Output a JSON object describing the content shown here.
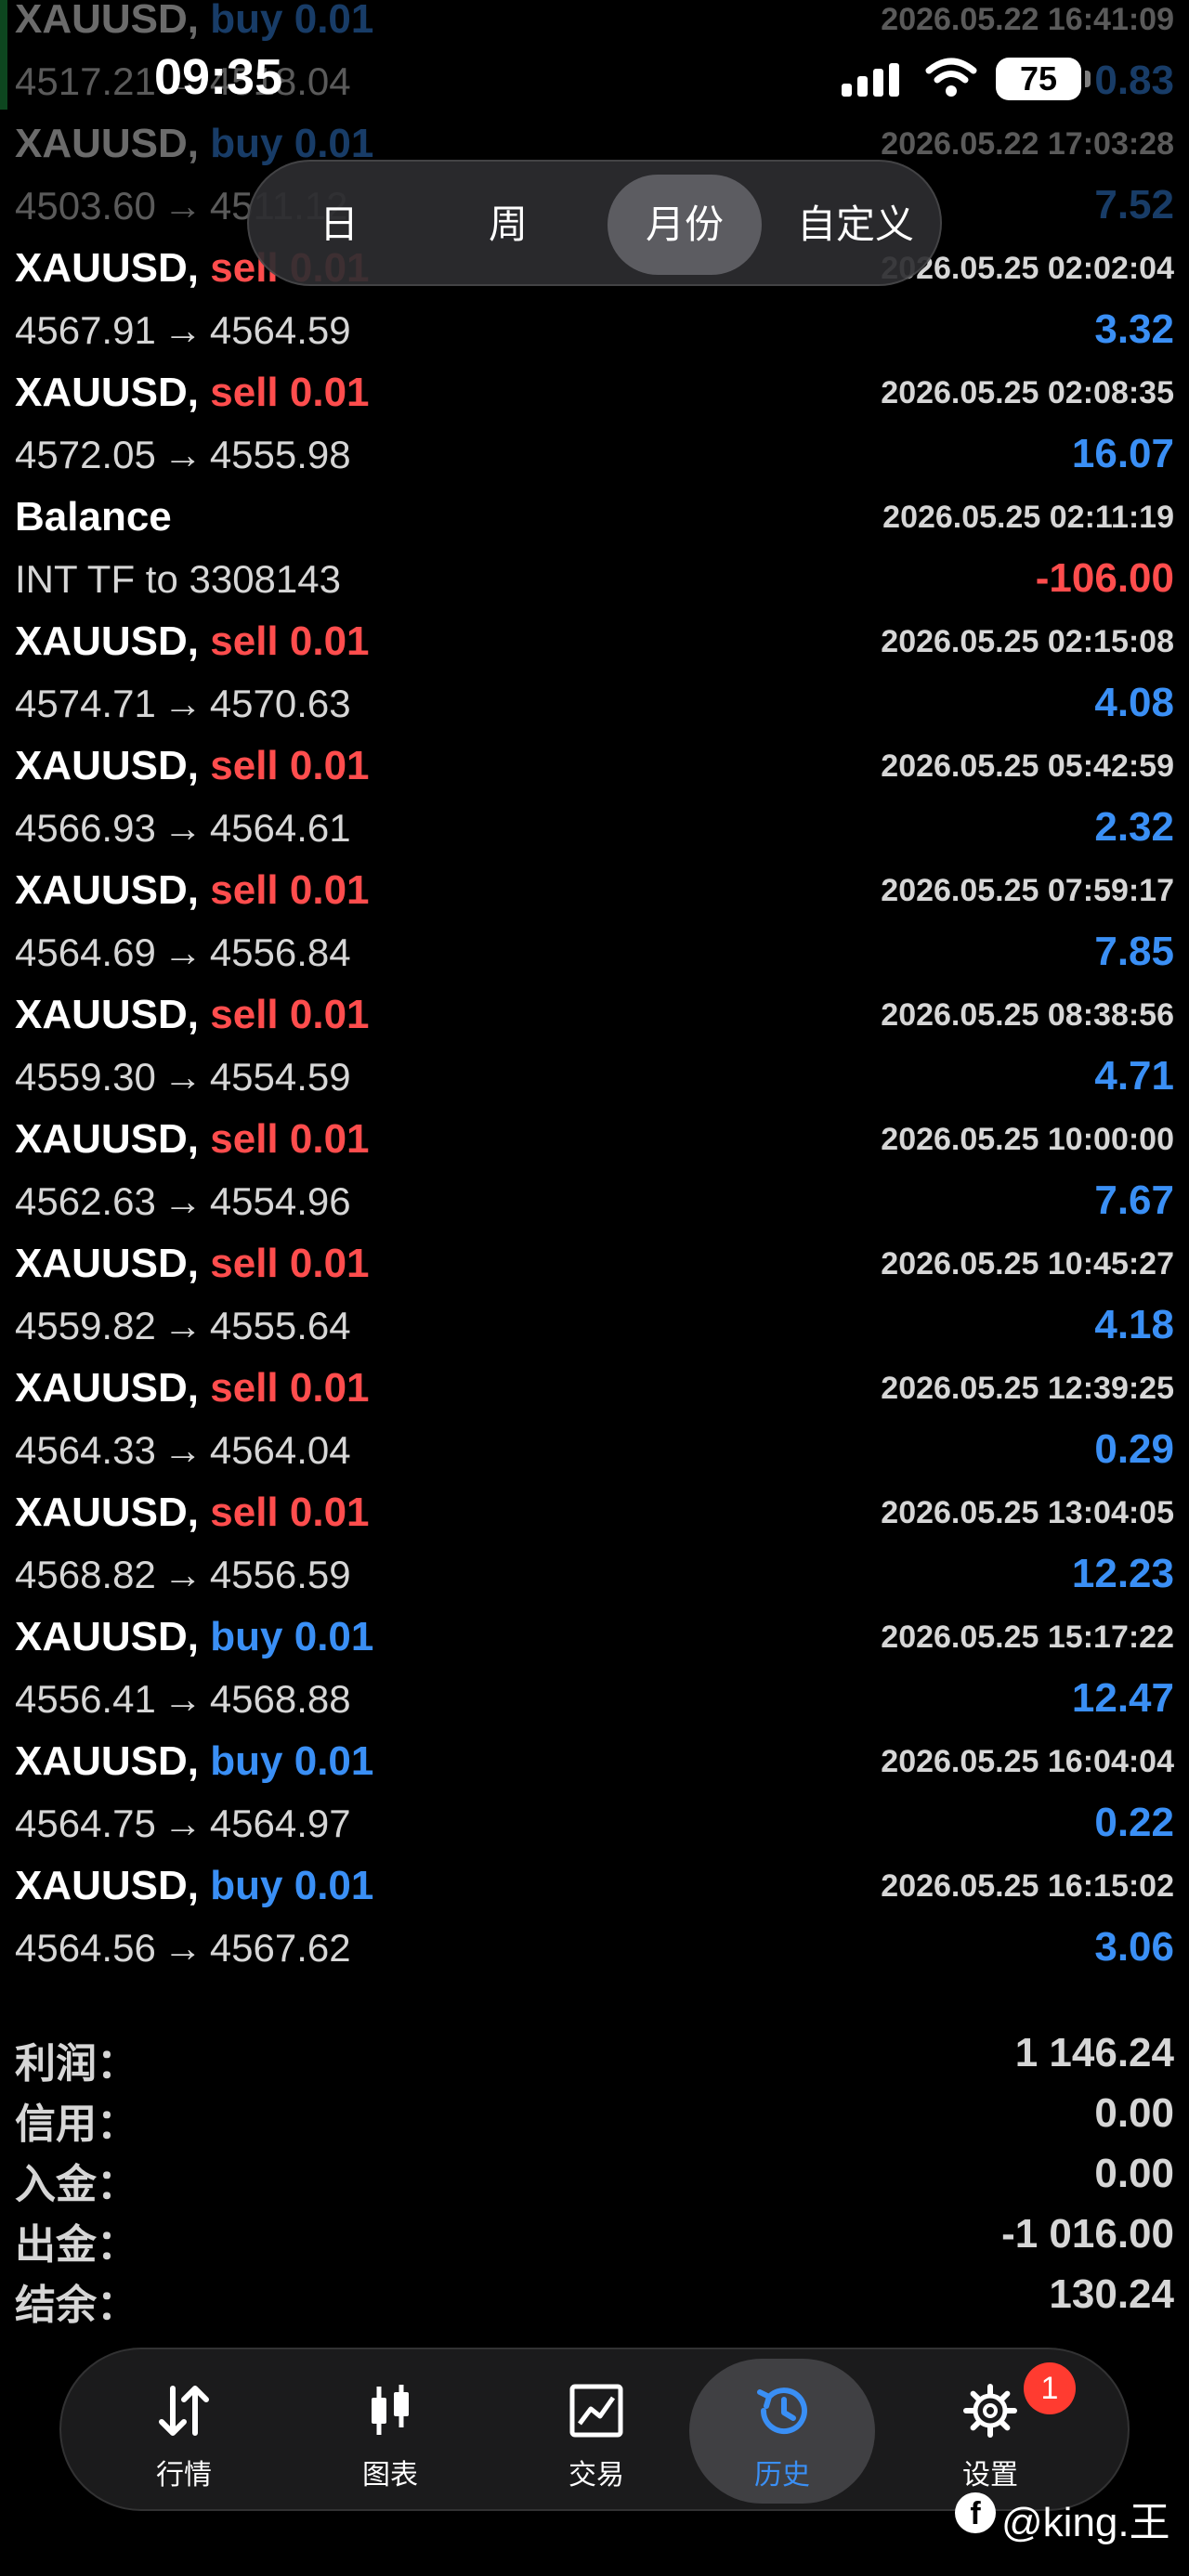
{
  "status_bar": {
    "time": "09:35",
    "battery": "75"
  },
  "period_tabs": [
    {
      "label": "日",
      "active": false
    },
    {
      "label": "周",
      "active": false
    },
    {
      "label": "月份",
      "active": true
    },
    {
      "label": "自定义",
      "active": false
    }
  ],
  "deals": [
    {
      "type": "trade",
      "symbol": "XAUUSD,",
      "side": "buy",
      "lot": "0.01",
      "time": "2026.05.22 16:41:09",
      "open": "4517.21",
      "close": "4518.04",
      "profit": "0.83"
    },
    {
      "type": "trade",
      "symbol": "XAUUSD,",
      "side": "buy",
      "lot": "0.01",
      "time": "2026.05.22 17:03:28",
      "open": "4503.60",
      "close": "4511.12",
      "profit": "7.52"
    },
    {
      "type": "trade",
      "symbol": "XAUUSD,",
      "side": "sell",
      "lot": "0.01",
      "time": "2026.05.25 02:02:04",
      "open": "4567.91",
      "close": "4564.59",
      "profit": "3.32"
    },
    {
      "type": "trade",
      "symbol": "XAUUSD,",
      "side": "sell",
      "lot": "0.01",
      "time": "2026.05.25 02:08:35",
      "open": "4572.05",
      "close": "4555.98",
      "profit": "16.07"
    },
    {
      "type": "balance",
      "title": "Balance",
      "comment": "INT TF to 3308143",
      "time": "2026.05.25 02:11:19",
      "profit": "-106.00"
    },
    {
      "type": "trade",
      "symbol": "XAUUSD,",
      "side": "sell",
      "lot": "0.01",
      "time": "2026.05.25 02:15:08",
      "open": "4574.71",
      "close": "4570.63",
      "profit": "4.08"
    },
    {
      "type": "trade",
      "symbol": "XAUUSD,",
      "side": "sell",
      "lot": "0.01",
      "time": "2026.05.25 05:42:59",
      "open": "4566.93",
      "close": "4564.61",
      "profit": "2.32"
    },
    {
      "type": "trade",
      "symbol": "XAUUSD,",
      "side": "sell",
      "lot": "0.01",
      "time": "2026.05.25 07:59:17",
      "open": "4564.69",
      "close": "4556.84",
      "profit": "7.85"
    },
    {
      "type": "trade",
      "symbol": "XAUUSD,",
      "side": "sell",
      "lot": "0.01",
      "time": "2026.05.25 08:38:56",
      "open": "4559.30",
      "close": "4554.59",
      "profit": "4.71"
    },
    {
      "type": "trade",
      "symbol": "XAUUSD,",
      "side": "sell",
      "lot": "0.01",
      "time": "2026.05.25 10:00:00",
      "open": "4562.63",
      "close": "4554.96",
      "profit": "7.67"
    },
    {
      "type": "trade",
      "symbol": "XAUUSD,",
      "side": "sell",
      "lot": "0.01",
      "time": "2026.05.25 10:45:27",
      "open": "4559.82",
      "close": "4555.64",
      "profit": "4.18"
    },
    {
      "type": "trade",
      "symbol": "XAUUSD,",
      "side": "sell",
      "lot": "0.01",
      "time": "2026.05.25 12:39:25",
      "open": "4564.33",
      "close": "4564.04",
      "profit": "0.29"
    },
    {
      "type": "trade",
      "symbol": "XAUUSD,",
      "side": "sell",
      "lot": "0.01",
      "time": "2026.05.25 13:04:05",
      "open": "4568.82",
      "close": "4556.59",
      "profit": "12.23"
    },
    {
      "type": "trade",
      "symbol": "XAUUSD,",
      "side": "buy",
      "lot": "0.01",
      "time": "2026.05.25 15:17:22",
      "open": "4556.41",
      "close": "4568.88",
      "profit": "12.47"
    },
    {
      "type": "trade",
      "symbol": "XAUUSD,",
      "side": "buy",
      "lot": "0.01",
      "time": "2026.05.25 16:04:04",
      "open": "4564.75",
      "close": "4564.97",
      "profit": "0.22"
    },
    {
      "type": "trade",
      "symbol": "XAUUSD,",
      "side": "buy",
      "lot": "0.01",
      "time": "2026.05.25 16:15:02",
      "open": "4564.56",
      "close": "4567.62",
      "profit": "3.06"
    }
  ],
  "arrow_symbol": "→",
  "summary": {
    "profit_label": "利润：",
    "profit": "1 146.24",
    "credit_label": "信用：",
    "credit": "0.00",
    "deposit_label": "入金：",
    "deposit": "0.00",
    "withdrawal_label": "出金：",
    "withdrawal": "-1 016.00",
    "balance_label": "结余：",
    "balance": "130.24"
  },
  "nav": {
    "quotes": "行情",
    "chart": "图表",
    "trade": "交易",
    "history": "历史",
    "settings": "设置",
    "settings_badge": "1",
    "active": "history"
  },
  "watermark": {
    "text": "@king.王"
  },
  "colors": {
    "buy": "#3a8ff5",
    "sell": "#ff4d4d",
    "profit_pos": "#3a8ff5",
    "profit_neg": "#ff4d4d",
    "background": "#000000"
  }
}
